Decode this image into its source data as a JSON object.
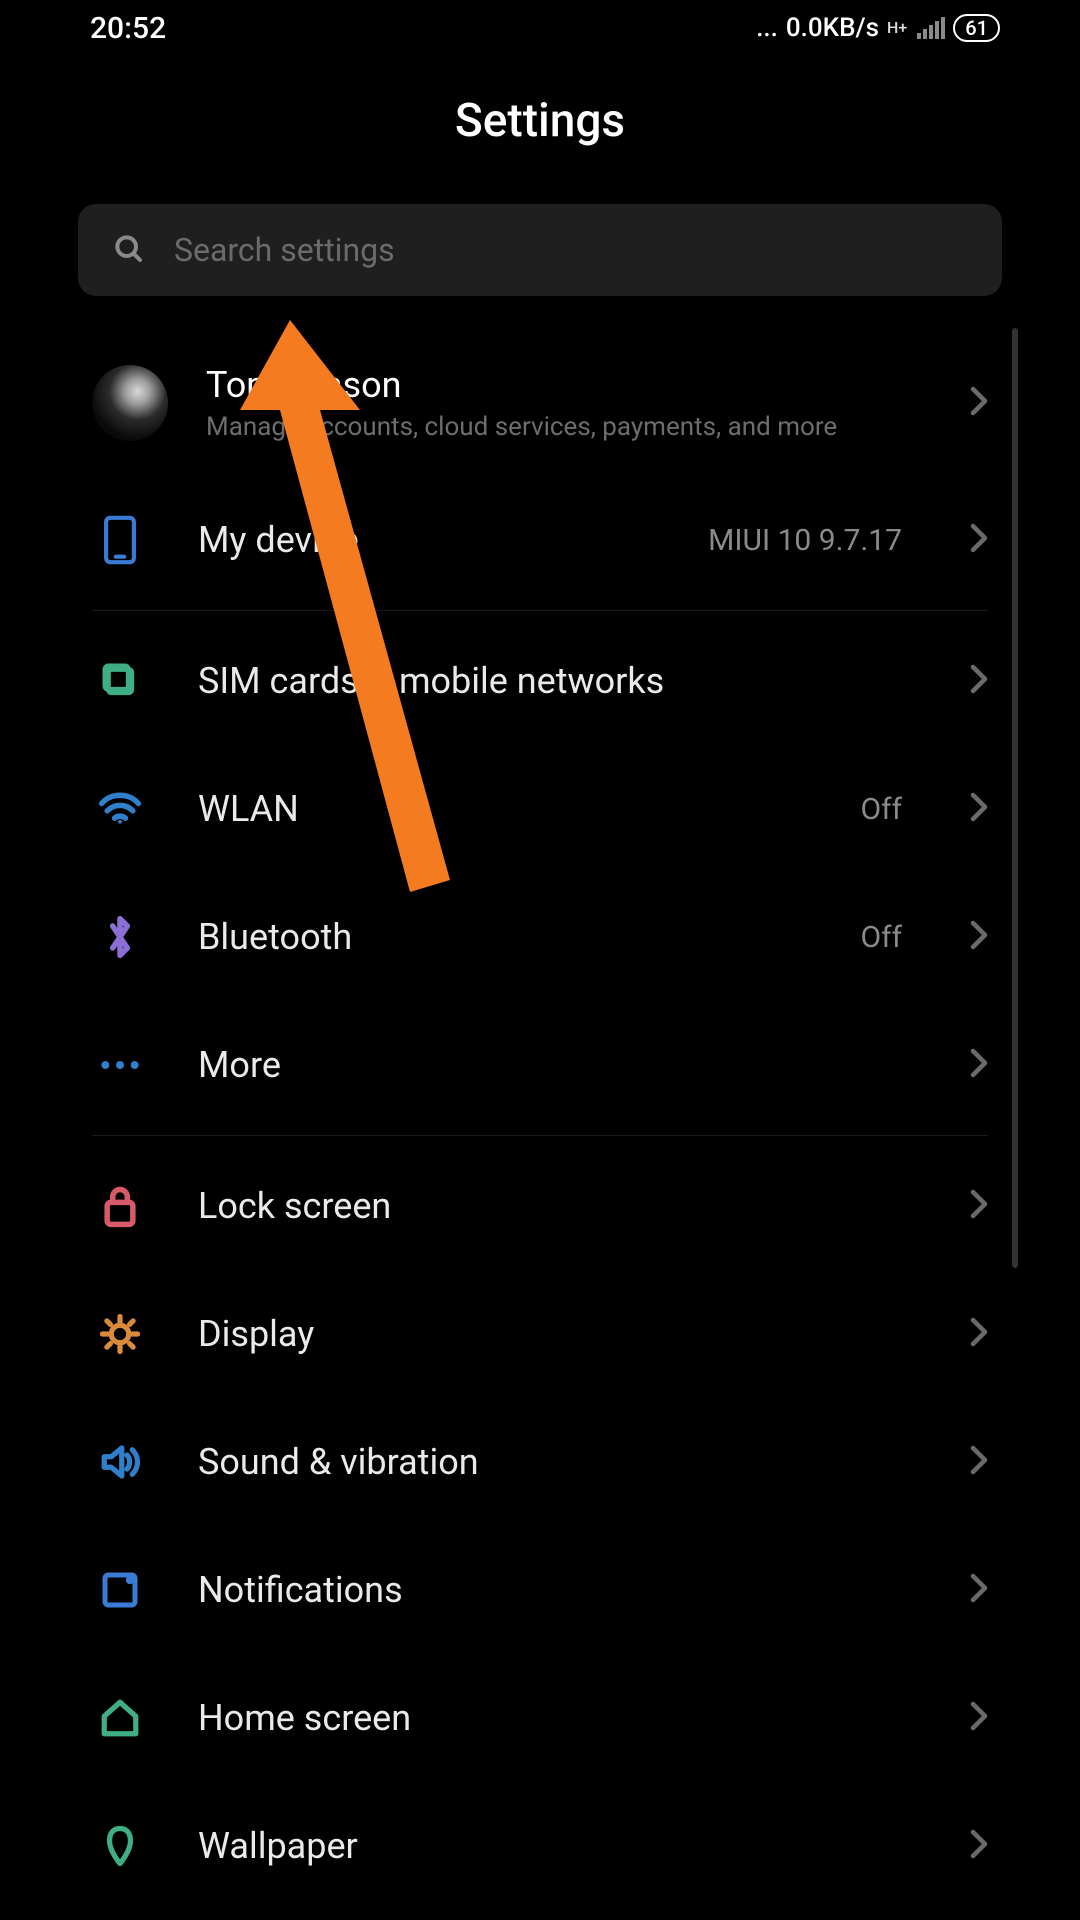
{
  "status_bar": {
    "time": "20:52",
    "dots": "...",
    "net_speed": "0.0KB/s",
    "net_type": "H+",
    "battery": "61"
  },
  "header": {
    "title": "Settings"
  },
  "search": {
    "placeholder": "Search settings"
  },
  "account": {
    "name": "TomHenson",
    "subtitle": "Manage accounts, cloud services, payments, and more"
  },
  "items": {
    "my_device": {
      "label": "My device",
      "value": "MIUI 10 9.7.17"
    },
    "sim": {
      "label": "SIM cards & mobile networks"
    },
    "wlan": {
      "label": "WLAN",
      "value": "Off"
    },
    "bluetooth": {
      "label": "Bluetooth",
      "value": "Off"
    },
    "more": {
      "label": "More"
    },
    "lock": {
      "label": "Lock screen"
    },
    "display": {
      "label": "Display"
    },
    "sound": {
      "label": "Sound & vibration"
    },
    "notifications": {
      "label": "Notifications"
    },
    "home": {
      "label": "Home screen"
    },
    "wallpaper": {
      "label": "Wallpaper"
    }
  },
  "colors": {
    "arrow": "#f47b20"
  }
}
